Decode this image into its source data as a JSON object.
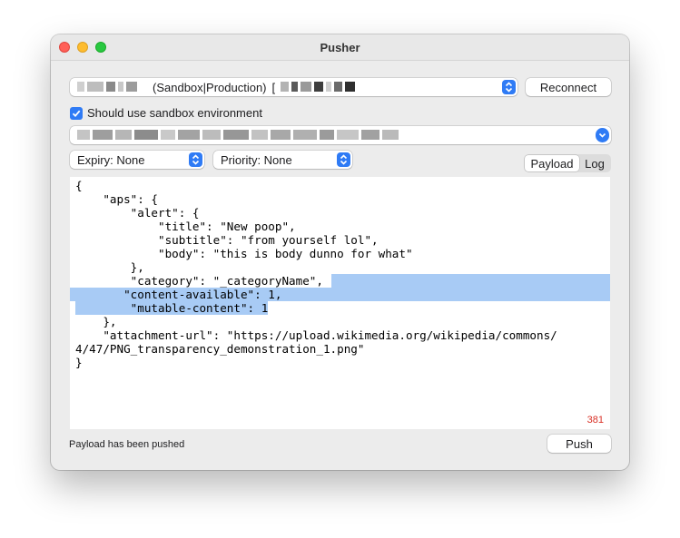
{
  "window": {
    "title": "Pusher"
  },
  "certificate": {
    "label": "(Sandbox|Production)",
    "bracket": "[",
    "reconnect_label": "Reconnect"
  },
  "sandbox": {
    "checked": true,
    "label": "Should use sandbox environment"
  },
  "device_token": {
    "value_redacted": true
  },
  "expiry": {
    "label": "Expiry: None"
  },
  "priority": {
    "label": "Priority: None"
  },
  "tabs": [
    {
      "label": "Payload",
      "active": true
    },
    {
      "label": "Log",
      "active": false
    }
  ],
  "payload": {
    "lines": [
      "{",
      "    \"aps\": {",
      "        \"alert\": {",
      "            \"title\": \"New poop\",",
      "            \"subtitle\": \"from yourself lol\",",
      "            \"body\": \"this is body dunno for what\"",
      "        },",
      "        \"category\": \"_categoryName\",",
      "       \"content-available\": 1,",
      "        \"mutable-content\": 1",
      "    },",
      "    \"attachment-url\": \"https://upload.wikimedia.org/wikipedia/commons/",
      "4/47/PNG_transparency_demonstration_1.png\"",
      "}"
    ],
    "char_count": "381"
  },
  "status": {
    "message": "Payload has been pushed"
  },
  "push": {
    "label": "Push"
  },
  "colors": {
    "accent": "#2f7bf5",
    "selection": "#a8cbf5",
    "count": "#d93025"
  }
}
